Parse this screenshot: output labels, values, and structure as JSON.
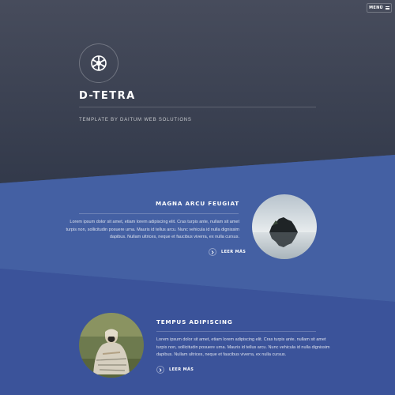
{
  "header": {
    "menu_label": "MENÚ",
    "site_title": "D-TETRA",
    "tagline": "TEMPLATE BY DAITUM WEB SOLUTIONS"
  },
  "articles": [
    {
      "heading": "MAGNA ARCU FEUGIAT",
      "body_lines": [
        "Lorem ipsum dolor sit amet, etiam lorem adipiscing elit. Cras turpis ante, nullam sit amet",
        "turpis non, sollicitudin posuere urna. Mauris id tellus arcu. Nunc vehicula id nulla dignissim",
        "dapibus. Nullam ultrices, neque et faucibus viverra, ex nulla cursus."
      ],
      "more_label": "LEER MÁS"
    },
    {
      "heading": "TEMPUS ADIPISCING",
      "body_lines": [
        "Lorem ipsum dolor sit amet, etiam lorem adipiscing elit. Cras turpis ante, nullam sit amet",
        "turpis non, sollicitudin posuere urna. Mauris id tellus arcu. Nunc vehicula id nulla dignissim",
        "dapibus. Nullam ultrices, neque et faucibus viverra, ex nulla cursus."
      ],
      "more_label": "LEER MÁS"
    }
  ],
  "colors": {
    "header_dark": "#293147",
    "section_blue": "#4460a3",
    "section_blue_dark": "#3b539a"
  },
  "icons": {
    "logo": "imperial-emblem-icon",
    "menu": "hamburger-icon",
    "more": "chevron-right-icon"
  }
}
